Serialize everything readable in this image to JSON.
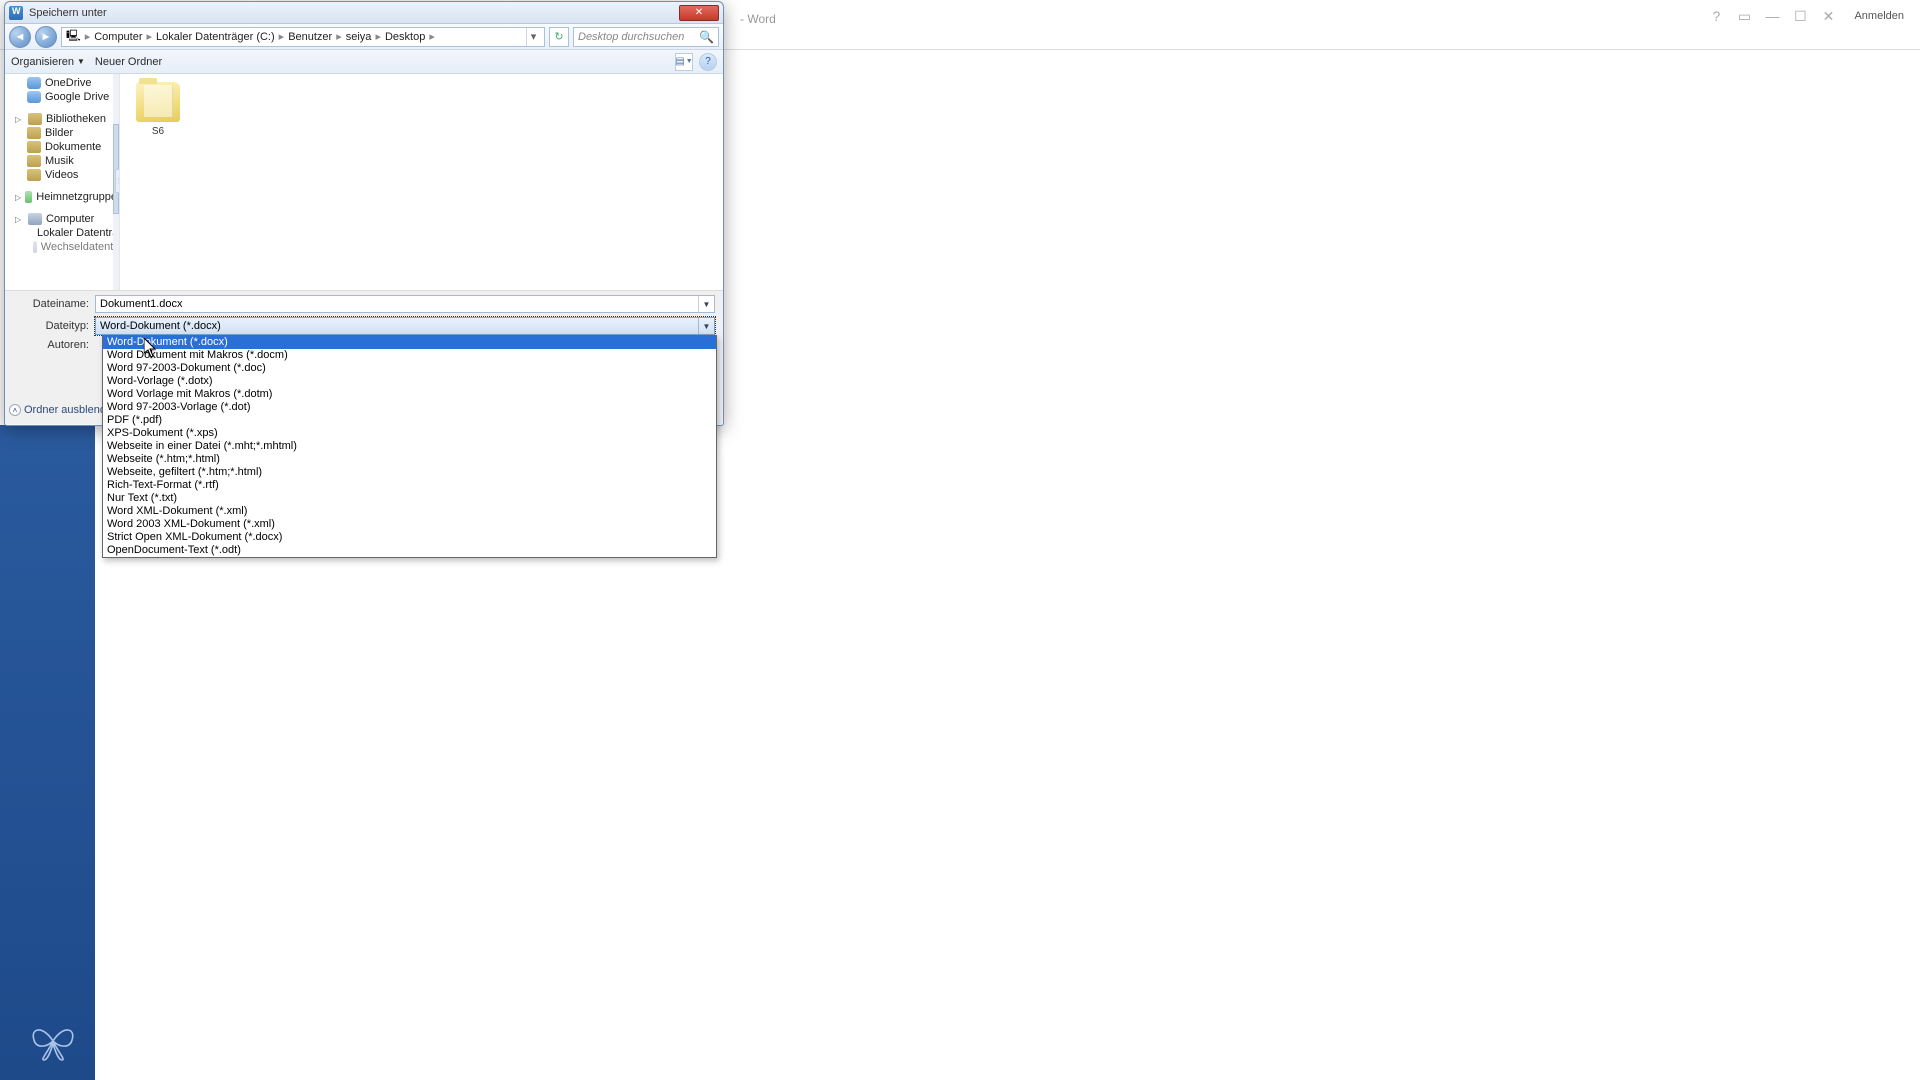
{
  "word": {
    "title_suffix": " - Word",
    "sign_in": "Anmelden"
  },
  "dialog": {
    "title": "Speichern unter",
    "breadcrumb": {
      "p0": "Computer",
      "p1": "Lokaler Datenträger (C:)",
      "p2": "Benutzer",
      "p3": "seiya",
      "p4": "Desktop"
    },
    "search_placeholder": "Desktop durchsuchen",
    "toolbar": {
      "organize": "Organisieren",
      "new_folder": "Neuer Ordner"
    },
    "tree": {
      "onedrive": "OneDrive",
      "gdrive": "Google Drive",
      "libraries": "Bibliotheken",
      "pictures": "Bilder",
      "documents": "Dokumente",
      "music": "Musik",
      "videos": "Videos",
      "homegroup": "Heimnetzgruppe",
      "computer": "Computer",
      "local_c": "Lokaler Datenträ",
      "extra": "Wechseldatentr"
    },
    "content": {
      "folder_name": "S6"
    },
    "form": {
      "filename_label": "Dateiname:",
      "filename_value": "Dokument1.docx",
      "filetype_label": "Dateityp:",
      "filetype_value": "Word-Dokument (*.docx)",
      "authors_label": "Autoren:"
    },
    "hide_folders": "Ordner ausblenden",
    "options": {
      "o0": "Word-Dokument (*.docx)",
      "o1": "Word Dokument mit Makros (*.docm)",
      "o2": "Word 97-2003-Dokument (*.doc)",
      "o3": "Word-Vorlage (*.dotx)",
      "o4": "Word Vorlage mit Makros (*.dotm)",
      "o5": "Word 97-2003-Vorlage (*.dot)",
      "o6": "PDF (*.pdf)",
      "o7": "XPS-Dokument (*.xps)",
      "o8": "Webseite in einer Datei (*.mht;*.mhtml)",
      "o9": "Webseite (*.htm;*.html)",
      "o10": "Webseite, gefiltert (*.htm;*.html)",
      "o11": "Rich-Text-Format (*.rtf)",
      "o12": "Nur Text (*.txt)",
      "o13": "Word XML-Dokument (*.xml)",
      "o14": "Word 2003 XML-Dokument (*.xml)",
      "o15": "Strict Open XML-Dokument (*.docx)",
      "o16": "OpenDocument-Text (*.odt)"
    }
  }
}
